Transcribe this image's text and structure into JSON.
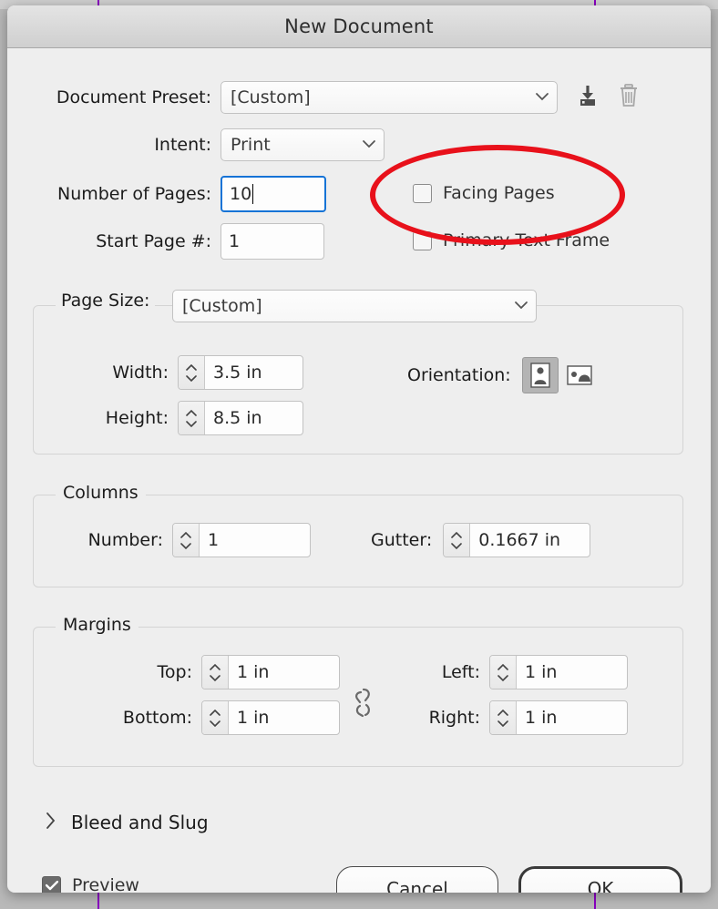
{
  "window": {
    "title": "New Document"
  },
  "preset_row": {
    "label": "Document Preset:",
    "value": "[Custom]",
    "caret": "chevron-down-icon",
    "save_icon": "save-preset-icon",
    "delete_icon": "trash-icon"
  },
  "intent_row": {
    "label": "Intent:",
    "value": "Print"
  },
  "pages_row": {
    "label": "Number of Pages:",
    "value": "10"
  },
  "start_row": {
    "label": "Start Page #:",
    "value": "1"
  },
  "checkboxes": {
    "facing_pages": {
      "label": "Facing Pages",
      "checked": false
    },
    "primary_text_frame": {
      "label": "Primary Text Frame",
      "checked": false
    }
  },
  "page_size": {
    "label": "Page Size:",
    "value": "[Custom]",
    "width": {
      "label": "Width:",
      "value": "3.5 in"
    },
    "height": {
      "label": "Height:",
      "value": "8.5 in"
    },
    "orientation": {
      "label": "Orientation:",
      "portrait": "portrait-orientation-icon",
      "landscape": "landscape-orientation-icon",
      "selected": "portrait"
    }
  },
  "columns": {
    "title": "Columns",
    "number": {
      "label": "Number:",
      "value": "1"
    },
    "gutter": {
      "label": "Gutter:",
      "value": "0.1667 in"
    }
  },
  "margins": {
    "title": "Margins",
    "top": {
      "label": "Top:",
      "value": "1 in"
    },
    "bottom": {
      "label": "Bottom:",
      "value": "1 in"
    },
    "left": {
      "label": "Left:",
      "value": "1 in"
    },
    "right": {
      "label": "Right:",
      "value": "1 in"
    },
    "link_icon": "broken-chain-link-icon",
    "linked": false
  },
  "bleed_and_slug": {
    "label": "Bleed and Slug",
    "chevron": "chevron-right-icon",
    "expanded": false
  },
  "footer": {
    "preview": {
      "label": "Preview",
      "checked": true
    },
    "cancel_label": "Cancel",
    "ok_label": "OK"
  },
  "annotation": {
    "shape": "red-ellipse-highlight",
    "color": "#e8111b",
    "targets": "Facing Pages"
  },
  "guides": {
    "color": "#8a00c2",
    "count": 2
  }
}
